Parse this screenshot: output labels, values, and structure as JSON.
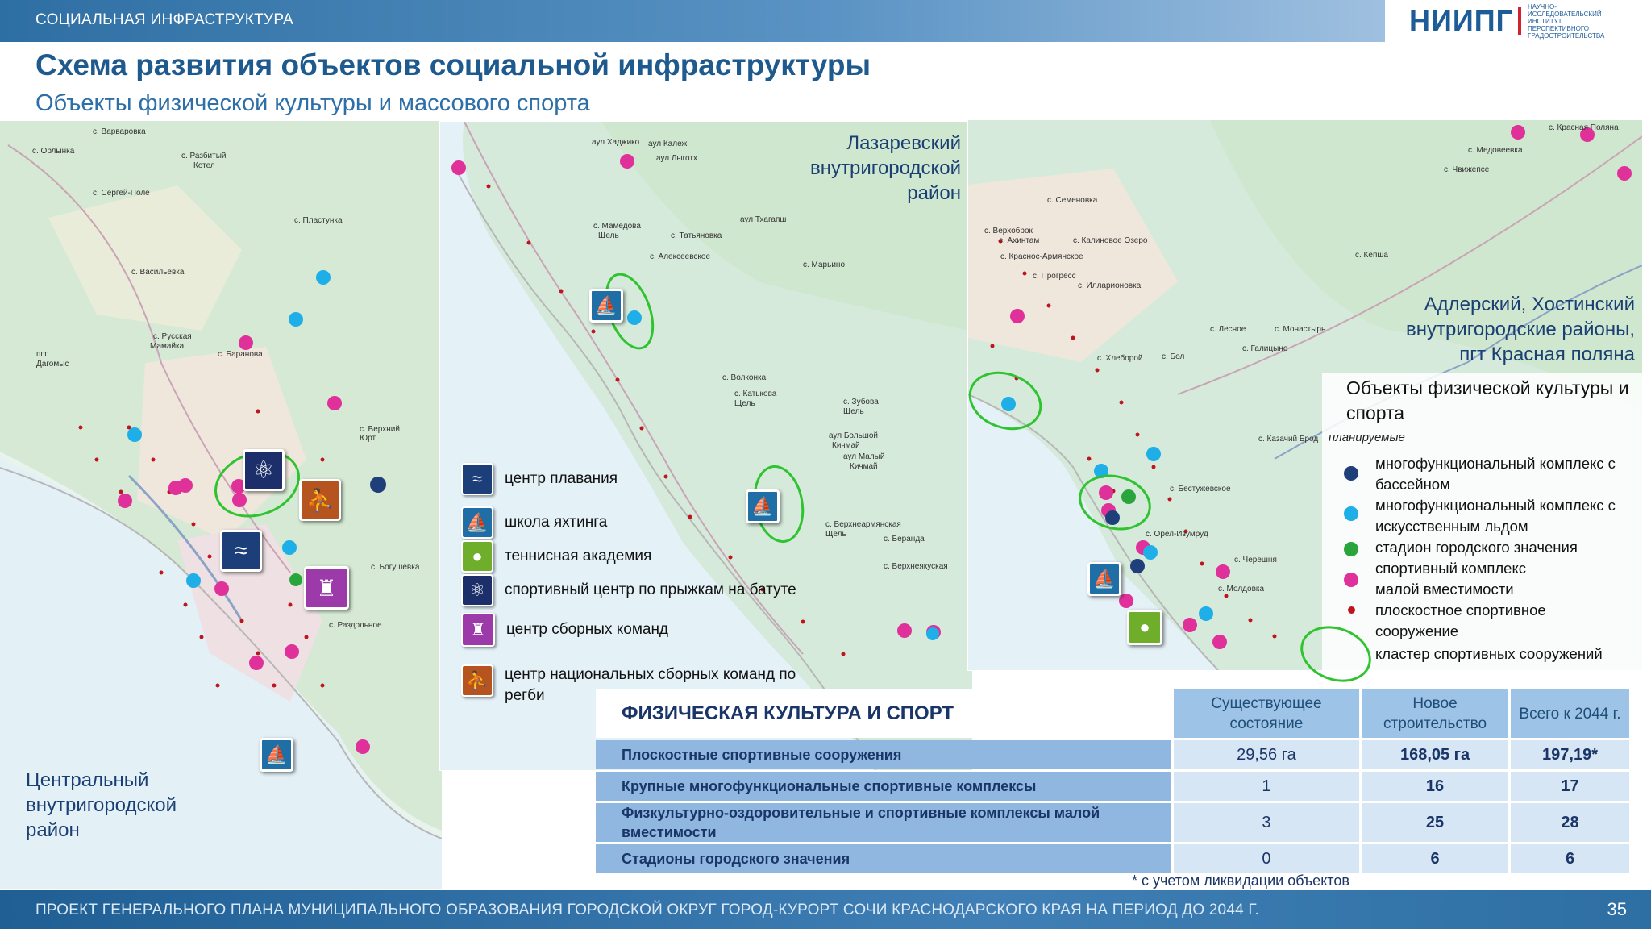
{
  "header": {
    "section": "СОЦИАЛЬНАЯ ИНФРАСТРУКТУРА",
    "logo": "НИИПГ",
    "logo_sub": "НАУЧНО-ИССЛЕДОВАТЕЛЬСКИЙ ИНСТИТУТ ПЕРСПЕКТИВНОГО ГРАДОСТРОИТЕЛЬСТВА"
  },
  "title": "Схема развития объектов социальной инфраструктуры",
  "subtitle": "Объекты физической культуры и массового спорта",
  "regions": {
    "central": [
      "Центральный",
      "внутригородской",
      "район"
    ],
    "lazarevsky": [
      "Лазаревский",
      "внутригородской",
      "район"
    ],
    "adler": [
      "Адлерский, Хостинский",
      "внутригородские районы,",
      "пгт Красная поляна"
    ]
  },
  "icon_legend": [
    {
      "icon": "swimming-icon",
      "label": "центр плавания",
      "color": "#1c3f7a"
    },
    {
      "icon": "sailboat-icon",
      "label": "школа яхтинга",
      "color": "#1f6fa6"
    },
    {
      "icon": "tennis-ball-icon",
      "label": "теннисная академия",
      "color": "#6fae2a"
    },
    {
      "icon": "trampoline-jumper-icon",
      "label": "спортивный центр по прыжкам на батуте",
      "color": "#1c2f6b"
    },
    {
      "icon": "national-teams-castle-icon",
      "label": "центр сборных команд",
      "color": "#9b3aa8"
    },
    {
      "icon": "rugby-player-icon",
      "label": "центр национальных сборных команд по регби",
      "color": "#b5541e"
    }
  ],
  "map_legend": {
    "title": "Объекты физической культуры и спорта",
    "sub": "планируемые",
    "items": [
      {
        "label": "многофункциональный комплекс с бассейном",
        "color": "#1f3f7a",
        "shape": "dot"
      },
      {
        "label": "многофункциональный комплекс с искусственным льдом",
        "color": "#1eaee8",
        "shape": "dot"
      },
      {
        "label": "стадион городского значения",
        "color": "#2aa53b",
        "shape": "dot"
      },
      {
        "label": "спортивный комплекс малой вместимости",
        "color": "#e0309a",
        "shape": "dot"
      },
      {
        "label": "плоскостное спортивное сооружение",
        "color": "#c0141d",
        "shape": "small-dot"
      },
      {
        "label": "кластер спортивных сооружений",
        "color": "#2fc42f",
        "shape": "ring"
      }
    ]
  },
  "table": {
    "title": "ФИЗИЧЕСКАЯ КУЛЬТУРА И СПОРТ",
    "columns": [
      "Существующее состояние",
      "Новое строительство",
      "Всего к 2044 г."
    ],
    "rows": [
      {
        "label": "Плоскостные спортивные сооружения",
        "values": [
          "29,56 га",
          "168,05 га",
          "197,19*"
        ]
      },
      {
        "label": "Крупные многофункциональные спортивные комплексы",
        "values": [
          "1",
          "16",
          "17"
        ]
      },
      {
        "label": "Физкультурно-оздоровительные и спортивные комплексы малой вместимости",
        "values": [
          "3",
          "25",
          "28"
        ]
      },
      {
        "label": "Стадионы городского значения",
        "values": [
          "0",
          "6",
          "6"
        ]
      }
    ],
    "footnote": "* с учетом ликвидации объектов"
  },
  "footer": {
    "text": "ПРОЕКТ ГЕНЕРАЛЬНОГО ПЛАНА МУНИЦИПАЛЬНОГО ОБРАЗОВАНИЯ ГОРОДСКОЙ ОКРУГ ГОРОД-КУРОРТ СОЧИ КРАСНОДАРСКОГО КРАЯ НА ПЕРИОД ДО 2044 Г.",
    "page": "35"
  },
  "colors": {
    "accent": "#1e5a8e",
    "sea": "#e4f1f7",
    "land": "#d6eadb"
  }
}
